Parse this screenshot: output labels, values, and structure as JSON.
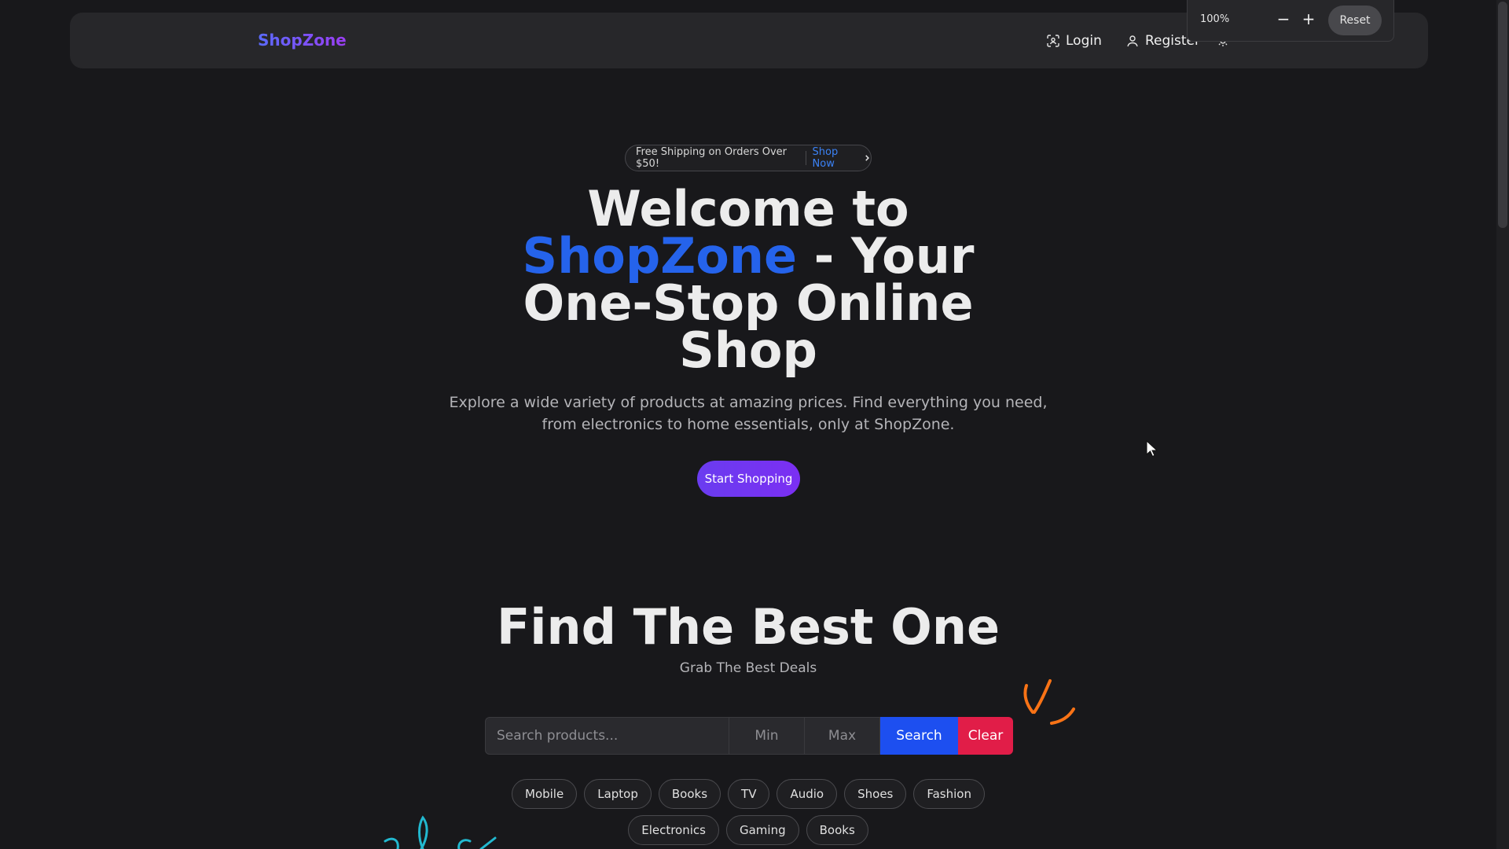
{
  "nav": {
    "logo": "ShopZone",
    "login_label": "Login",
    "register_label": "Register"
  },
  "zoom": {
    "level": "100%",
    "minus_label": "−",
    "plus_label": "+",
    "reset_label": "Reset"
  },
  "promo": {
    "text": "Free Shipping on Orders Over $50!",
    "link_label": "Shop Now"
  },
  "hero": {
    "title_prefix": "Welcome to",
    "title_brand": "ShopZone",
    "title_suffix": "- Your One-Stop Online Shop",
    "subtitle": "Explore a wide variety of products at amazing prices. Find everything you need, from electronics to home essentials, only at ShopZone.",
    "cta_label": "Start Shopping"
  },
  "find": {
    "title": "Find The Best One",
    "subtitle": "Grab The Best Deals"
  },
  "search": {
    "placeholder": "Search products...",
    "min_placeholder": "Min",
    "max_placeholder": "Max",
    "search_label": "Search",
    "clear_label": "Clear"
  },
  "categories_row1": [
    "Mobile",
    "Laptop",
    "Books",
    "TV",
    "Audio",
    "Shoes",
    "Fashion"
  ],
  "categories_row2": [
    "Electronics",
    "Gaming",
    "Books"
  ],
  "colors": {
    "accent_blue": "#2563eb",
    "cta_purple": "#6a3cf0",
    "clear_red": "#e11d48",
    "background": "#18181b"
  }
}
